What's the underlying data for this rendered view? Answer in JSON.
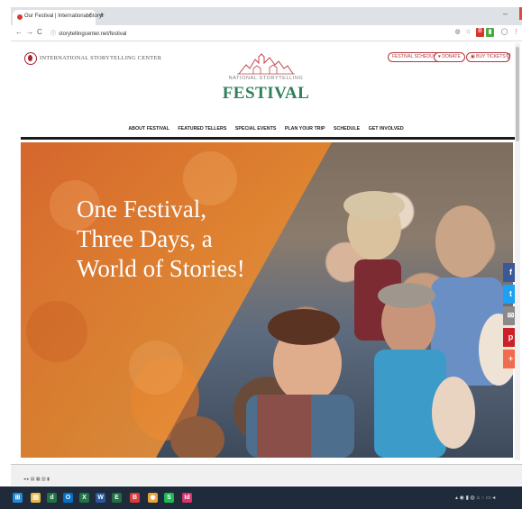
{
  "browser": {
    "tab_title": "Our Festival | International Storyt",
    "tab_close": "✕",
    "new_tab": "+",
    "url": "storytellingcenter.net/festival",
    "window_min": "–",
    "window_close": "x",
    "nav_back": "←",
    "nav_forward": "→",
    "nav_reload": "C"
  },
  "site": {
    "org_name": "INTERNATIONAL STORYTELLING CENTER",
    "logo_sub": "NATIONAL STORYTELLING",
    "logo_main": "FESTIVAL",
    "header_buttons": [
      {
        "label": "FESTIVAL SCHEDULE"
      },
      {
        "label": "♥ DONATE"
      },
      {
        "label": "▣ BUY TICKETS"
      }
    ],
    "search_glyph": "⚲",
    "nav_items": [
      {
        "label": "ABOUT FESTIVAL"
      },
      {
        "label": "FEATURED TELLERS"
      },
      {
        "label": "SPECIAL EVENTS"
      },
      {
        "label": "PLAN YOUR TRIP"
      },
      {
        "label": "SCHEDULE"
      },
      {
        "label": "GET INVOLVED"
      }
    ],
    "hero_lines": [
      "One Festival,",
      "Three Days, a",
      "World of Stories!"
    ]
  },
  "social": [
    {
      "glyph": "f",
      "color": "#3b5998"
    },
    {
      "glyph": "t",
      "color": "#1da1f2"
    },
    {
      "glyph": "✉",
      "color": "#8a8a8a"
    },
    {
      "glyph": "p",
      "color": "#cb2027"
    },
    {
      "glyph": "+",
      "color": "#f26b4c"
    }
  ],
  "icons": {
    "tab_favicon": "storytelling-favicon",
    "lock": "lock-icon",
    "star": "bookmark-star-icon",
    "search": "search-icon",
    "windows": "windows-start-icon"
  },
  "colors": {
    "brand_red": "#b3373d",
    "festival_green": "#2f7f5a",
    "hero_orange": "#e8842a"
  },
  "taskbar": {
    "apps": [
      {
        "glyph": "⊞",
        "color": "#1f8ad8"
      },
      {
        "glyph": "▤",
        "color": "#e8b94a"
      },
      {
        "glyph": "d",
        "color": "#217346"
      },
      {
        "glyph": "O",
        "color": "#0072c6"
      },
      {
        "glyph": "X",
        "color": "#217346"
      },
      {
        "glyph": "W",
        "color": "#2b579a"
      },
      {
        "glyph": "E",
        "color": "#1e7145"
      },
      {
        "glyph": "B",
        "color": "#e03a3a"
      },
      {
        "glyph": "◉",
        "color": "#e8a33d"
      },
      {
        "glyph": "S",
        "color": "#1db954"
      },
      {
        "glyph": "Id",
        "color": "#d8336e"
      }
    ]
  }
}
